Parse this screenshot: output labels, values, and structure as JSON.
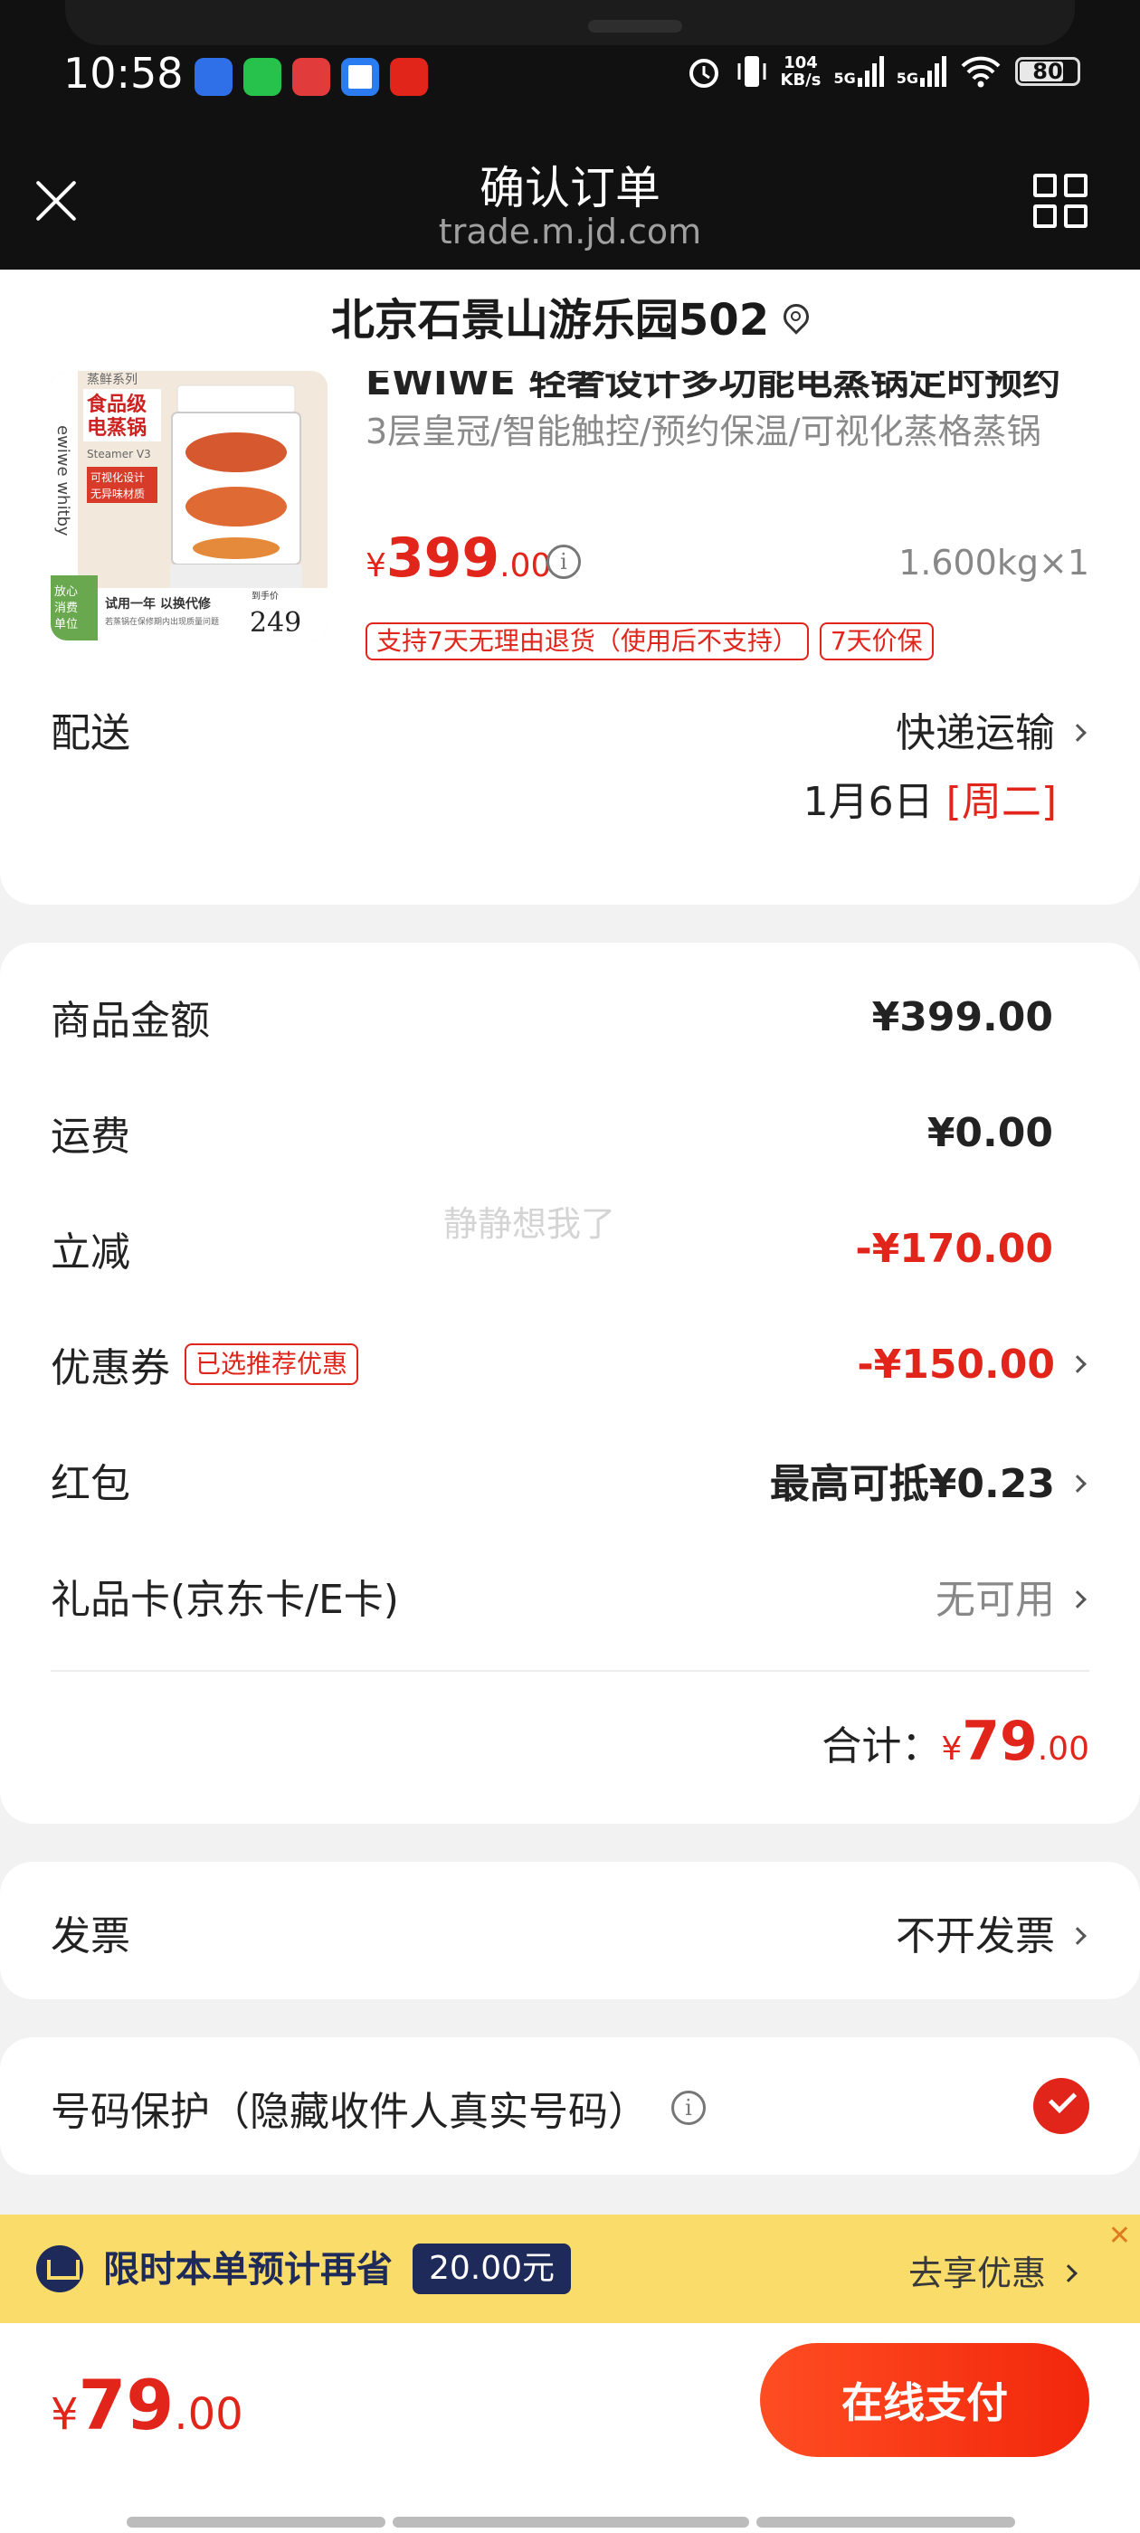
{
  "status_bar": {
    "time": "10:58",
    "net_speed_value": "104",
    "net_speed_unit": "KB/s",
    "signal1": "5G",
    "signal2": "5G",
    "battery": "80"
  },
  "header": {
    "title": "确认订单",
    "url": "trade.m.jd.com"
  },
  "address": {
    "text": "北京石景山游乐园502"
  },
  "product": {
    "title": "EWIWE 轻奢设计多功能电蒸锅定时预约",
    "spec": "3层皇冠/智能触控/预约保温/可视化蒸格蒸锅",
    "price_symbol": "¥",
    "price_int": "399",
    "price_dec": ".00",
    "weight_qty": "1.600kg×1",
    "tags": [
      "支持7天无理由退货（使用后不支持）",
      "7天价保"
    ],
    "thumb": {
      "series": "蒸鲜系列",
      "model": "Steamer V3",
      "headline1": "食品级",
      "headline2": "电蒸锅",
      "sub1": "可视化设计",
      "sub2": "无异味材质",
      "trial": "试用一年  以换代修",
      "trial_sub": "若蒸锅在保修期内出现质量问题",
      "badge1": "放心",
      "badge2": "消费",
      "badge3": "单位",
      "price_label": "到手价",
      "price": "249",
      "brand": "ewiwe whitby"
    }
  },
  "delivery": {
    "label": "配送",
    "method": "快递运输",
    "date": "1月6日",
    "weekday": "[周二]"
  },
  "amounts": {
    "goods_label": "商品金额",
    "goods_value": "¥399.00",
    "shipping_label": "运费",
    "shipping_value": "¥0.00",
    "discount_label": "立减",
    "discount_value": "-¥170.00",
    "coupon_label": "优惠券",
    "coupon_tag": "已选推荐优惠",
    "coupon_value": "-¥150.00",
    "redpacket_label": "红包",
    "redpacket_value": "最高可抵¥0.23",
    "giftcard_label": "礼品卡(京东卡/E卡)",
    "giftcard_value": "无可用",
    "total_label": "合计：",
    "total_symbol": "¥",
    "total_int": "79",
    "total_dec": ".00",
    "watermark": "静静想我了"
  },
  "invoice": {
    "label": "发票",
    "value": "不开发票"
  },
  "privacy": {
    "label": "号码保护（隐藏收件人真实号码）",
    "checked": true
  },
  "promo": {
    "text": "限时本单预计再省",
    "amount": "20.00元",
    "link": "去享优惠",
    "close": "✕"
  },
  "bottom": {
    "price_symbol": "¥",
    "price_int": "79",
    "price_dec": ".00",
    "pay_label": "在线支付"
  },
  "colors": {
    "accent": "#e1251b",
    "banner": "#f9dc6a",
    "banner_text": "#1e2a5a"
  }
}
